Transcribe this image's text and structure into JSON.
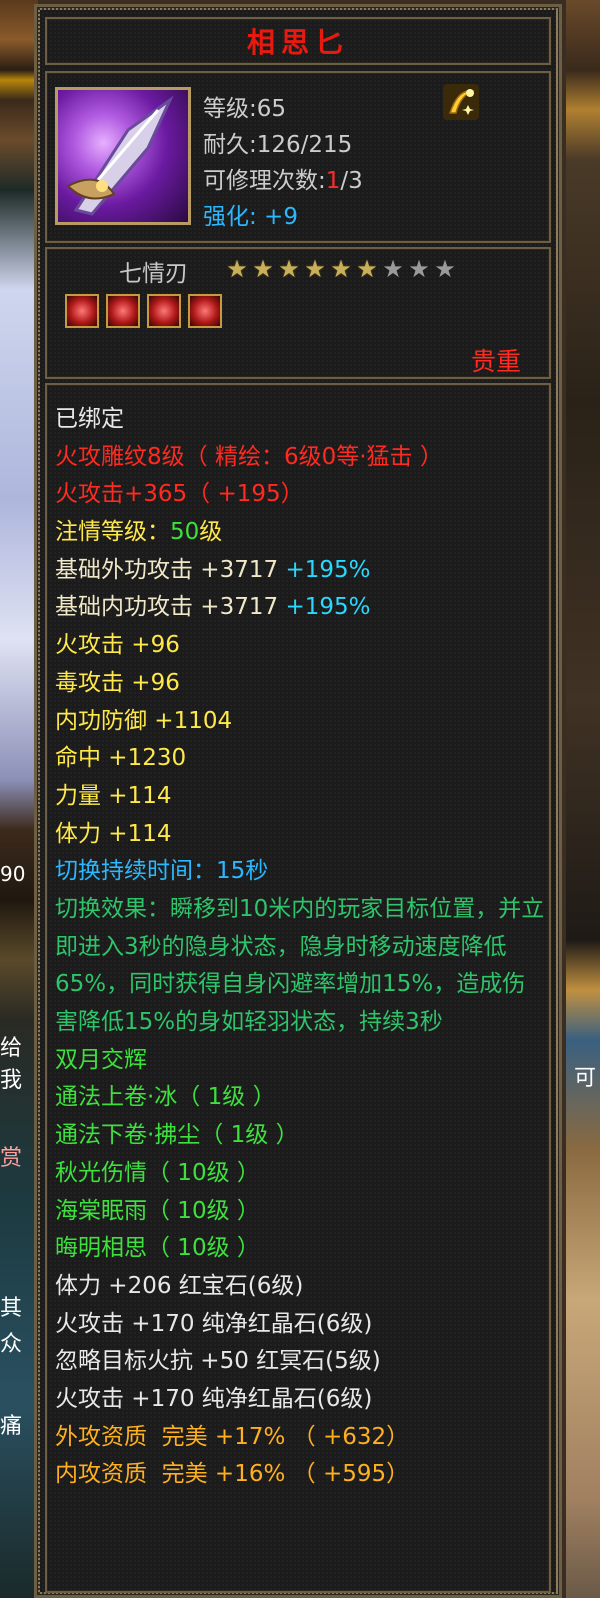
{
  "background": {
    "left_fragments": [
      "90",
      "给我",
      "赏",
      "其",
      "众",
      "痛"
    ],
    "right_fragments": [
      "可"
    ]
  },
  "tooltip": {
    "title": "相思匕",
    "stats": {
      "level": "等级:65",
      "durability": "耐久:126/215",
      "repair_prefix": "可修理次数:",
      "repair_used": "1",
      "repair_total": "/3",
      "enhance": "强化: +9"
    },
    "item_name": "七情刃",
    "stars": {
      "filled": 6,
      "total": 9
    },
    "sockets": [
      "red-gem-socket",
      "red-gem-socket",
      "red-gem-socket",
      "red-gem-socket"
    ],
    "rarity": "贵重",
    "attributes": [
      {
        "parts": [
          {
            "text": "已绑定",
            "color": "white"
          }
        ]
      },
      {
        "parts": [
          {
            "text": "火攻雕纹8级（ 精绘：6级0等·猛击 ）",
            "color": "red"
          }
        ]
      },
      {
        "parts": [
          {
            "text": "火攻击+365（ +195）",
            "color": "red"
          }
        ]
      },
      {
        "parts": [
          {
            "text": "注情等级：",
            "color": "yellow"
          },
          {
            "text": "50",
            "color": "green"
          },
          {
            "text": "级",
            "color": "yellow"
          }
        ]
      },
      {
        "parts": [
          {
            "text": "基础外功攻击 +3717 ",
            "color": "pale"
          },
          {
            "text": "+195%",
            "color": "cyan"
          }
        ]
      },
      {
        "parts": [
          {
            "text": "基础内功攻击 +3717 ",
            "color": "pale"
          },
          {
            "text": "+195%",
            "color": "cyan"
          }
        ]
      },
      {
        "parts": [
          {
            "text": "火攻击 +96",
            "color": "yellow"
          }
        ]
      },
      {
        "parts": [
          {
            "text": "毒攻击 +96",
            "color": "yellow"
          }
        ]
      },
      {
        "parts": [
          {
            "text": "内功防御 +1104",
            "color": "yellow"
          }
        ]
      },
      {
        "parts": [
          {
            "text": "命中 +1230",
            "color": "yellow"
          }
        ]
      },
      {
        "parts": [
          {
            "text": "力量 +114",
            "color": "yellow"
          }
        ]
      },
      {
        "parts": [
          {
            "text": "体力 +114",
            "color": "yellow"
          }
        ]
      },
      {
        "parts": [
          {
            "text": "切换持续时间：15秒",
            "color": "blue"
          }
        ]
      },
      {
        "wrap": true,
        "parts": [
          {
            "text": "切换效果：瞬移到10米内的玩家目标位置，并立即进入3秒的隐身状态，隐身时移动速度降低65%，同时获得自身闪避率增加15%，造成伤害降低15%的身如轻羽状态，持续3秒",
            "color": "teal"
          }
        ]
      },
      {
        "parts": [
          {
            "text": "双月交辉",
            "color": "green"
          }
        ]
      },
      {
        "parts": [
          {
            "text": "通法上卷·冰（ 1级 ）",
            "color": "green"
          }
        ]
      },
      {
        "parts": [
          {
            "text": "通法下卷·拂尘（ 1级 ）",
            "color": "green"
          }
        ]
      },
      {
        "parts": [
          {
            "text": "秋光伤情（ 10级 ）",
            "color": "green"
          }
        ]
      },
      {
        "parts": [
          {
            "text": "海棠眠雨（ 10级 ）",
            "color": "green"
          }
        ]
      },
      {
        "parts": [
          {
            "text": "晦明相思（ 10级 ）",
            "color": "green"
          }
        ]
      },
      {
        "parts": [
          {
            "text": "体力 +206 红宝石(6级)",
            "color": "white"
          }
        ]
      },
      {
        "parts": [
          {
            "text": "火攻击 +170 纯净红晶石(6级)",
            "color": "white"
          }
        ]
      },
      {
        "parts": [
          {
            "text": "忽略目标火抗 +50 红冥石(5级)",
            "color": "white"
          }
        ]
      },
      {
        "parts": [
          {
            "text": "火攻击 +170 纯净红晶石(6级)",
            "color": "white"
          }
        ]
      },
      {
        "parts": [
          {
            "text": "外攻资质  完美 +17% （ +632）",
            "color": "orange"
          }
        ]
      },
      {
        "parts": [
          {
            "text": "内攻资质  完美 +16% （ +595）",
            "color": "orange"
          }
        ]
      }
    ]
  }
}
